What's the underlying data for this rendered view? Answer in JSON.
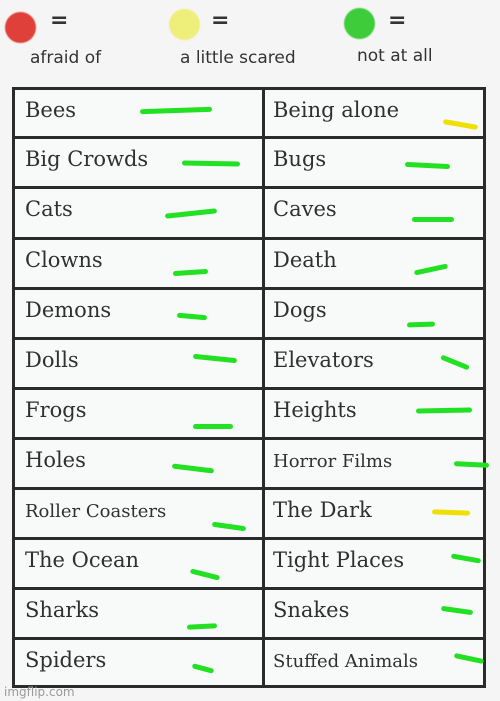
{
  "legend": [
    {
      "color": "#e0403a",
      "symbol": "=",
      "label": "afraid of"
    },
    {
      "color": "#eeee7a",
      "symbol": "=",
      "label": "a little scared"
    },
    {
      "color": "#3ecc3a",
      "symbol": "=",
      "label": "not at all"
    }
  ],
  "mark_colors": {
    "not_at_all": "#22e022",
    "a_little_scared": "#f0e000"
  },
  "rows": [
    {
      "left": {
        "text": "Bees",
        "mark": "not_at_all"
      },
      "right": {
        "text": "Being alone",
        "mark": "a_little_scared"
      }
    },
    {
      "left": {
        "text": "Big Crowds",
        "mark": "not_at_all"
      },
      "right": {
        "text": "Bugs",
        "mark": "not_at_all"
      }
    },
    {
      "left": {
        "text": "Cats",
        "mark": "not_at_all"
      },
      "right": {
        "text": "Caves",
        "mark": "not_at_all"
      }
    },
    {
      "left": {
        "text": "Clowns",
        "mark": "not_at_all"
      },
      "right": {
        "text": "Death",
        "mark": "not_at_all"
      }
    },
    {
      "left": {
        "text": "Demons",
        "mark": "not_at_all"
      },
      "right": {
        "text": "Dogs",
        "mark": "not_at_all"
      }
    },
    {
      "left": {
        "text": "Dolls",
        "mark": "not_at_all"
      },
      "right": {
        "text": "Elevators",
        "mark": "not_at_all"
      }
    },
    {
      "left": {
        "text": "Frogs",
        "mark": "not_at_all"
      },
      "right": {
        "text": "Heights",
        "mark": "not_at_all"
      }
    },
    {
      "left": {
        "text": "Holes",
        "mark": "not_at_all"
      },
      "right": {
        "text": "Horror Films",
        "mark": "not_at_all"
      }
    },
    {
      "left": {
        "text": "Roller Coasters",
        "mark": "not_at_all"
      },
      "right": {
        "text": "The Dark",
        "mark": "a_little_scared"
      }
    },
    {
      "left": {
        "text": "The Ocean",
        "mark": "not_at_all"
      },
      "right": {
        "text": "Tight Places",
        "mark": "not_at_all"
      }
    },
    {
      "left": {
        "text": "Sharks",
        "mark": "not_at_all"
      },
      "right": {
        "text": "Snakes",
        "mark": "not_at_all"
      }
    },
    {
      "left": {
        "text": "Spiders",
        "mark": "not_at_all"
      },
      "right": {
        "text": "Stuffed Animals",
        "mark": "not_at_all"
      }
    }
  ],
  "watermark": "imgflip.com"
}
